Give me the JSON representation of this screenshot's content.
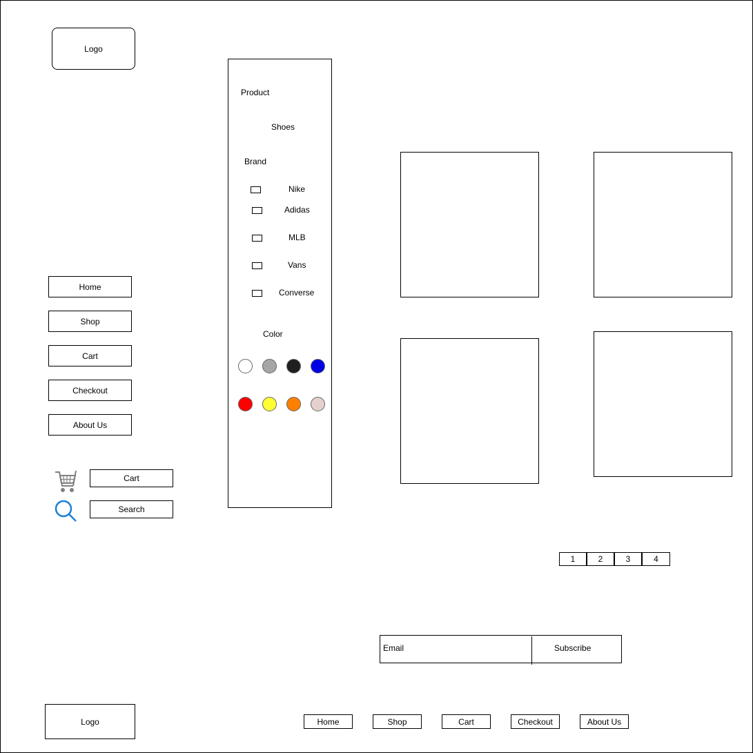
{
  "header": {
    "logo_label": "Logo"
  },
  "nav": {
    "items": [
      "Home",
      "Shop",
      "Cart",
      "Checkout",
      "About Us"
    ]
  },
  "utility": {
    "cart_label": "Cart",
    "search_label": "Search",
    "cart_icon": "cart-icon",
    "search_icon": "search-icon",
    "icon_color": "#1a7fd6"
  },
  "filters": {
    "product_label": "Product",
    "product_value": "Shoes",
    "brand_label": "Brand",
    "brands": [
      "Nike",
      "Adidas",
      "MLB",
      "Vans",
      "Converse"
    ],
    "color_label": "Color",
    "colors": [
      "#ffffff",
      "#a6a6a6",
      "#1f1f1f",
      "#0000e6",
      "#ff0000",
      "#ffff33",
      "#ff8000",
      "#e6d0ce"
    ]
  },
  "pagination": {
    "pages": [
      "1",
      "2",
      "3",
      "4"
    ]
  },
  "newsletter": {
    "email_placeholder": "Email",
    "subscribe_label": "Subscribe"
  },
  "footer": {
    "logo_label": "Logo",
    "links": [
      "Home",
      "Shop",
      "Cart",
      "Checkout",
      "About Us"
    ]
  }
}
